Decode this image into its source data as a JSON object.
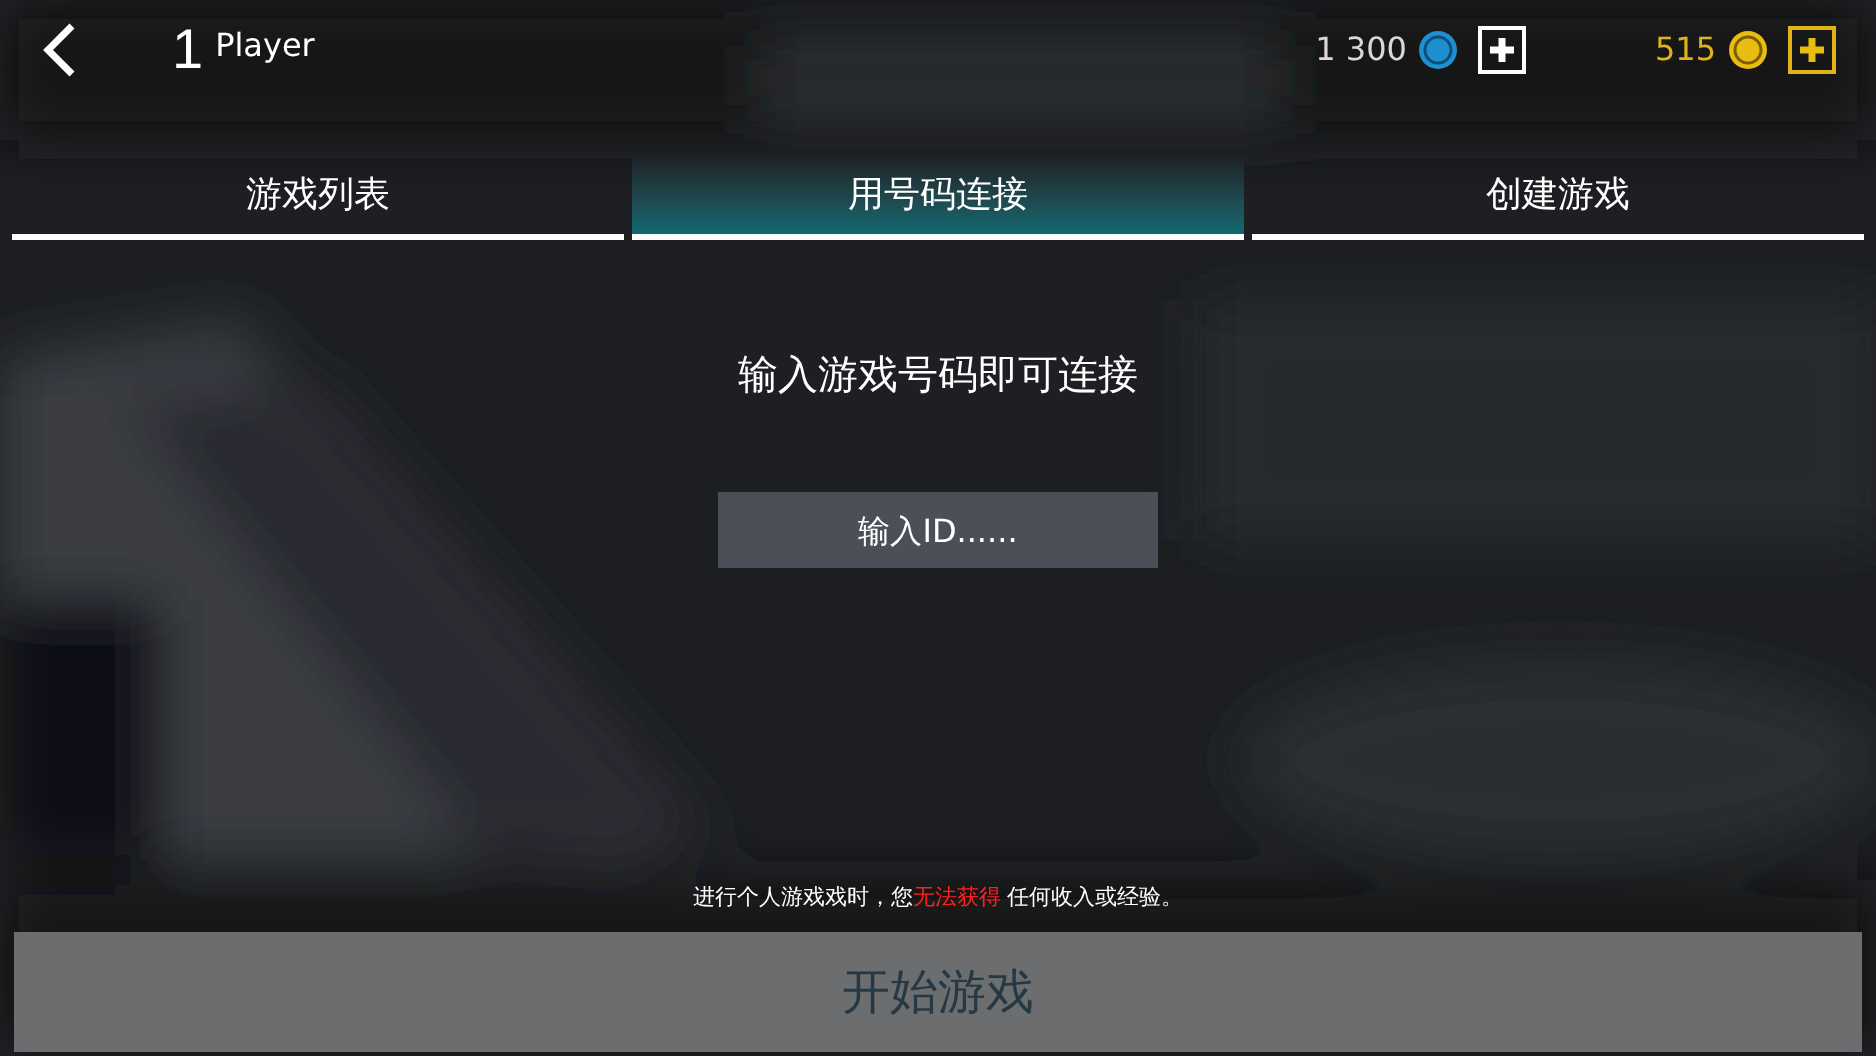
{
  "header": {
    "player_count": "1",
    "player_label": "Player",
    "credits": "1 300",
    "gold": "515"
  },
  "tabs": [
    {
      "label": "游戏列表",
      "selected": false
    },
    {
      "label": "用号码连接",
      "selected": true
    },
    {
      "label": "创建游戏",
      "selected": false
    }
  ],
  "prompt": "输入游戏号码即可连接",
  "id_field": {
    "placeholder": "输入ID......"
  },
  "notice": {
    "before": "进行个人游戏戏时，您",
    "warning": "无法获得",
    "after": " 任何收入或经验。"
  },
  "start_button": "开始游戏"
}
